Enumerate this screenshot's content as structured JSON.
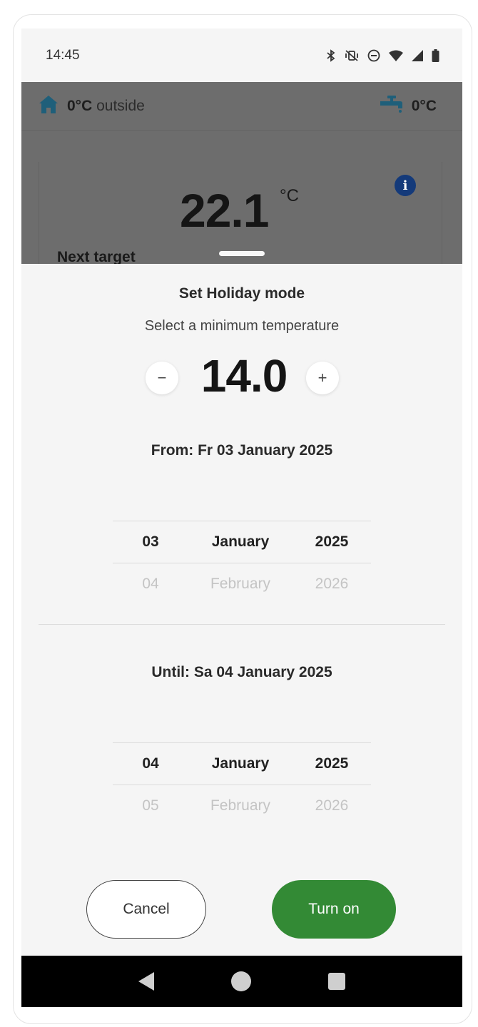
{
  "status_bar": {
    "time": "14:45",
    "icons": [
      "bluetooth-icon",
      "mute-vibrate-icon",
      "do-not-disturb-icon",
      "wifi-icon",
      "cell-signal-icon",
      "battery-icon"
    ]
  },
  "background_app": {
    "outside_temp": "0°C",
    "outside_label": "outside",
    "water_temp": "0°C",
    "current_temp": "22.1",
    "current_unit": "°C",
    "next_target_label": "Next target"
  },
  "sheet": {
    "title": "Set Holiday mode",
    "subtitle": "Select a minimum temperature",
    "min_temperature": "14.0",
    "minus_label": "−",
    "plus_label": "+",
    "from_label": "From: Fr 03 January 2025",
    "from_picker": {
      "selected": {
        "day": "03",
        "month": "January",
        "year": "2025"
      },
      "next": {
        "day": "04",
        "month": "February",
        "year": "2026"
      }
    },
    "until_label": "Until: Sa 04 January 2025",
    "until_picker": {
      "selected": {
        "day": "04",
        "month": "January",
        "year": "2025"
      },
      "next": {
        "day": "05",
        "month": "February",
        "year": "2026"
      }
    },
    "cancel_label": "Cancel",
    "turn_on_label": "Turn on"
  },
  "colors": {
    "accent_green": "#338a35",
    "info_blue": "#143a7a",
    "icon_teal": "#1f5f7a"
  }
}
